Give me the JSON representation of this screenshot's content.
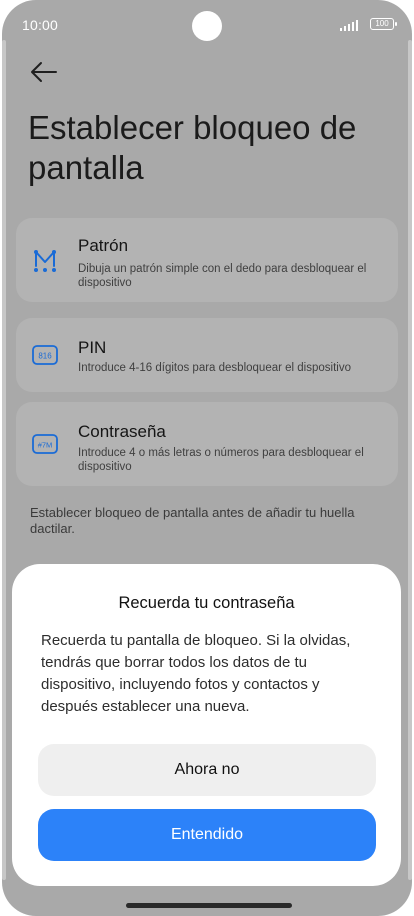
{
  "status_bar": {
    "time": "10:00",
    "battery": "100"
  },
  "header": {
    "title": "Establecer bloqueo de pantalla"
  },
  "options": [
    {
      "icon": "pattern-icon",
      "title": "Patrón",
      "description": "Dibuja un patrón simple con el dedo para desbloquear el dispositivo"
    },
    {
      "icon": "pin-icon",
      "icon_text": "816",
      "title": "PIN",
      "description": "Introduce 4-16 dígitos para desbloquear el dispositivo"
    },
    {
      "icon": "password-icon",
      "icon_text": "#7M",
      "title": "Contraseña",
      "description": "Introduce 4 o más letras o números para desbloquear el dispositivo"
    }
  ],
  "note": "Establecer bloqueo de pantalla antes de añadir tu huella dactilar.",
  "dialog": {
    "title": "Recuerda tu contraseña",
    "body": "Recuerda tu pantalla de bloqueo. Si la olvidas, tendrás que borrar todos los datos de tu dispositivo, incluyendo fotos y contactos y después establecer una nueva.",
    "secondary_label": "Ahora no",
    "primary_label": "Entendido"
  },
  "colors": {
    "accent": "#2c82f9",
    "icon_blue": "#1a6bd6",
    "scrim": "#a9a9a9"
  }
}
